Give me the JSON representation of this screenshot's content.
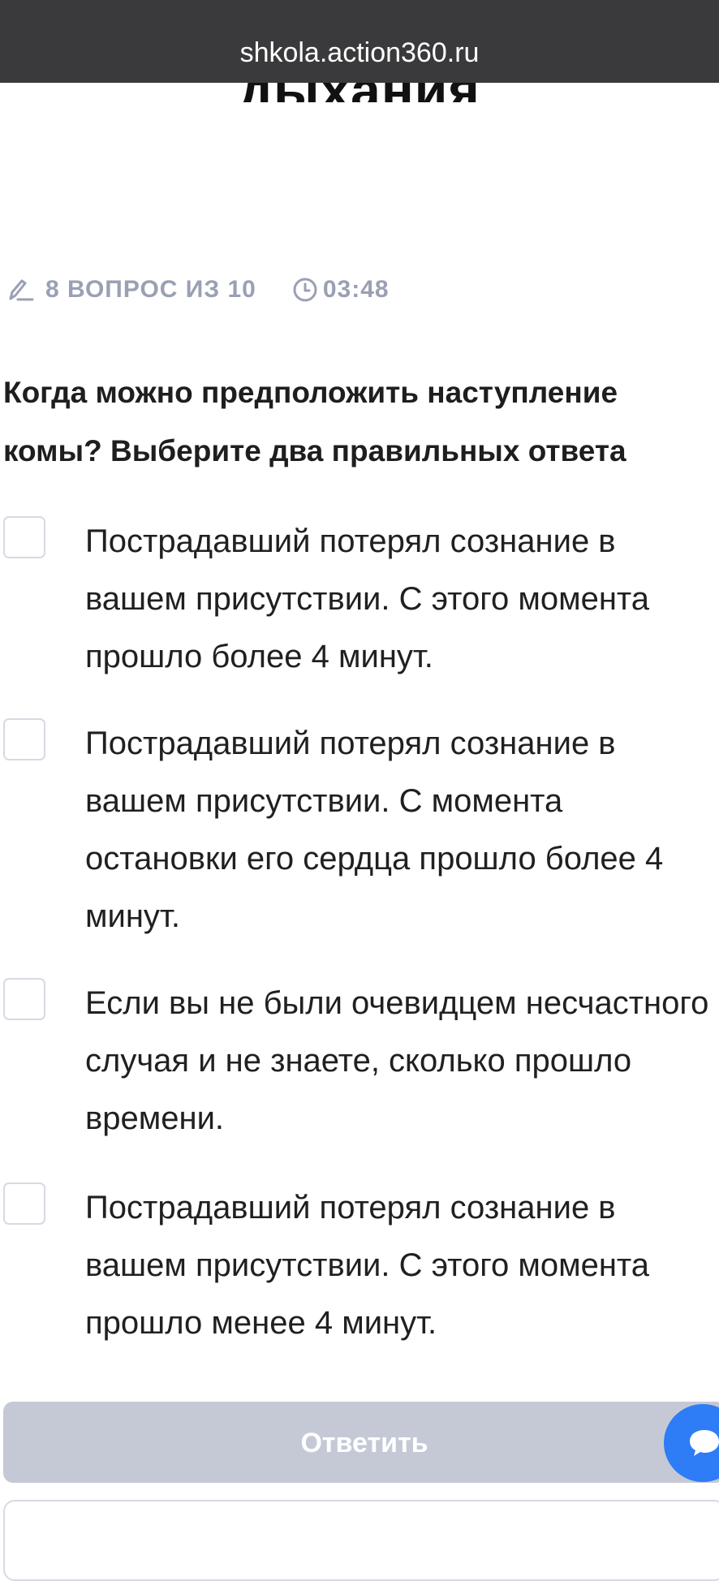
{
  "browser": {
    "url": "shkola.action360.ru"
  },
  "page": {
    "title": "дыхания"
  },
  "quiz": {
    "progress_label": "8 ВОПРОС ИЗ 10",
    "timer": "03:48",
    "question": "Когда можно предположить наступление комы? Выберите два правильных ответа",
    "options": [
      {
        "text": "Пострадавший потерял сознание в вашем присутствии. С этого момента прошло более 4 минут.",
        "checked": false
      },
      {
        "text": "Пострадавший потерял сознание в вашем присутствии. С момента остановки его сердца прошло более 4 минут.",
        "checked": false
      },
      {
        "text": "Если вы не были очевидцем несчастного случая и не знаете, сколько прошло времени.",
        "checked": false
      },
      {
        "text": "Пострадавший потерял сознание в вашем присутствии. С этого момента прошло менее 4 минут.",
        "checked": false
      }
    ],
    "submit_label": "Ответить"
  },
  "icons": {
    "progress": "pencil-icon",
    "timer": "clock-icon",
    "chat": "chat-bubble-icon"
  },
  "colors": {
    "accent": "#2e7cf6",
    "submit_disabled": "#c5c9d6",
    "meta_text": "#9aa0b4",
    "url_bar": "#3a3a3c"
  }
}
